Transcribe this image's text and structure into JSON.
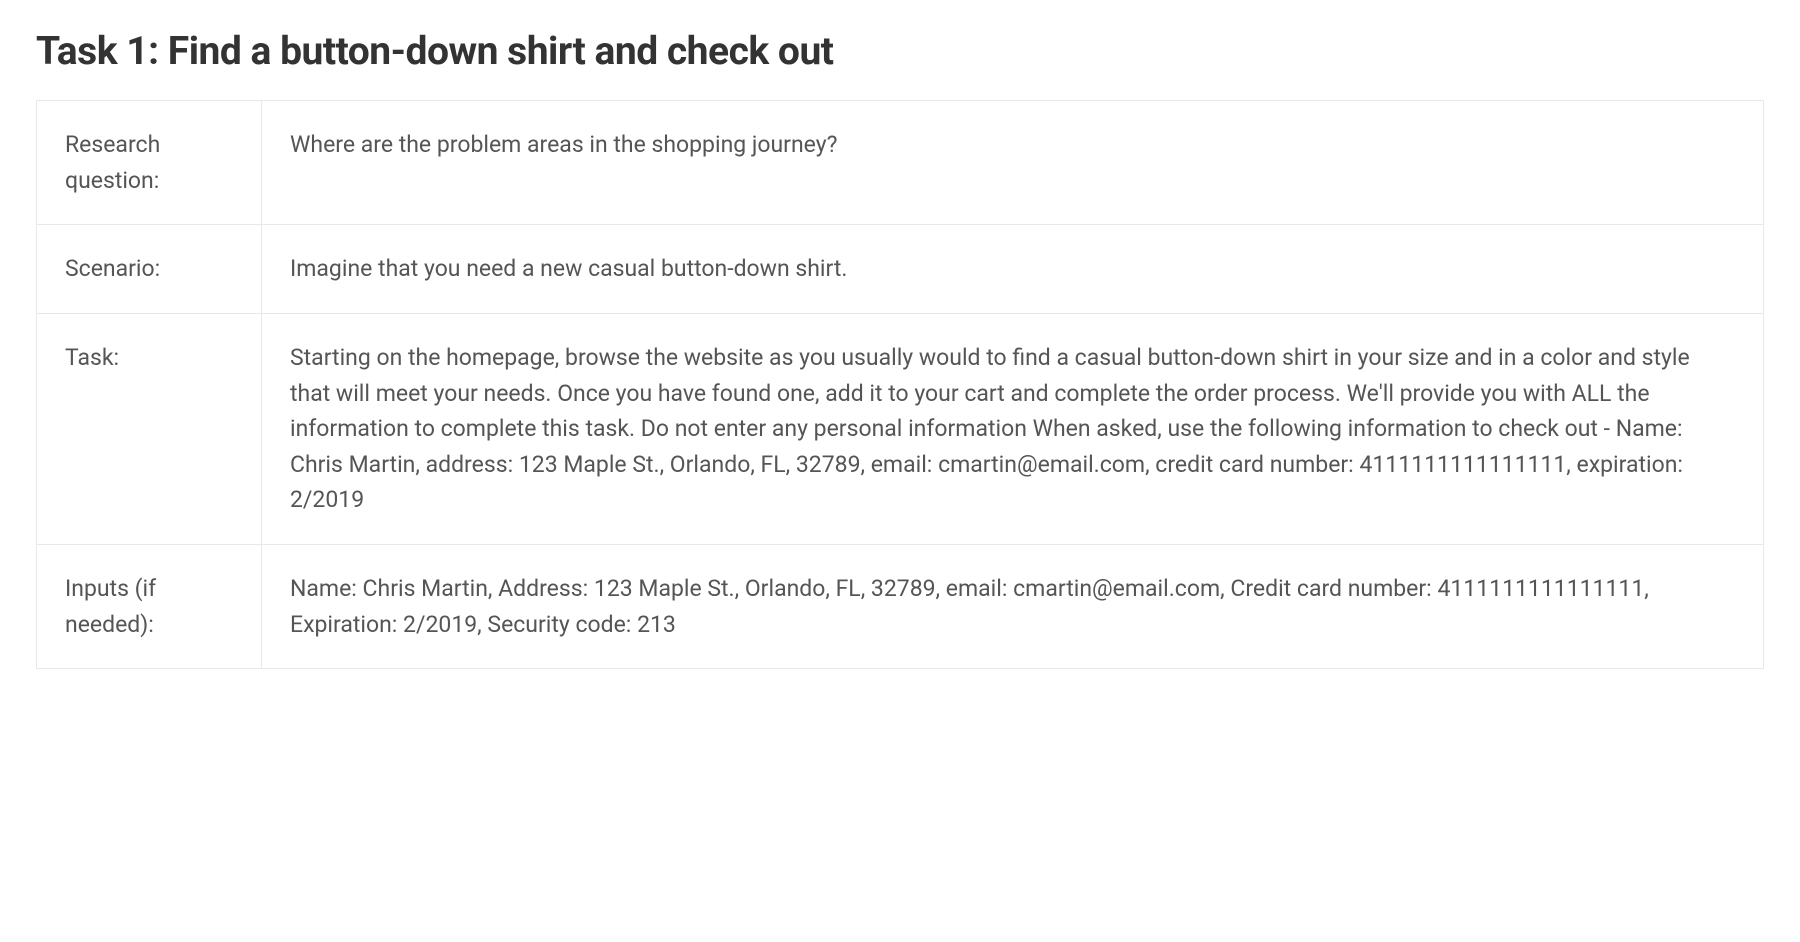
{
  "title": "Task 1: Find a button-down shirt and check out",
  "rows": [
    {
      "label": "Research question:",
      "value": "Where are the problem areas in the shopping journey?"
    },
    {
      "label": "Scenario:",
      "value": "Imagine that you need a new casual button-down shirt."
    },
    {
      "label": "Task:",
      "value": "Starting on the homepage, browse the website as you usually would to find a casual button-down shirt in your size and in a color and style that will meet your needs. Once you have found one, add it to your cart and complete the order process. We'll provide you with ALL the information to complete this task. Do not enter any personal information When asked, use the following information to check out - Name: Chris Martin, address: 123 Maple St., Orlando, FL, 32789, email: cmartin@email.com, credit card number: 4111111111111111, expiration: 2/2019"
    },
    {
      "label": "Inputs (if needed):",
      "value": "Name: Chris Martin, Address: 123 Maple St., Orlando, FL, 32789, email: cmartin@email.com, Credit card number: 4111111111111111, Expiration: 2/2019, Security code: 213"
    }
  ]
}
